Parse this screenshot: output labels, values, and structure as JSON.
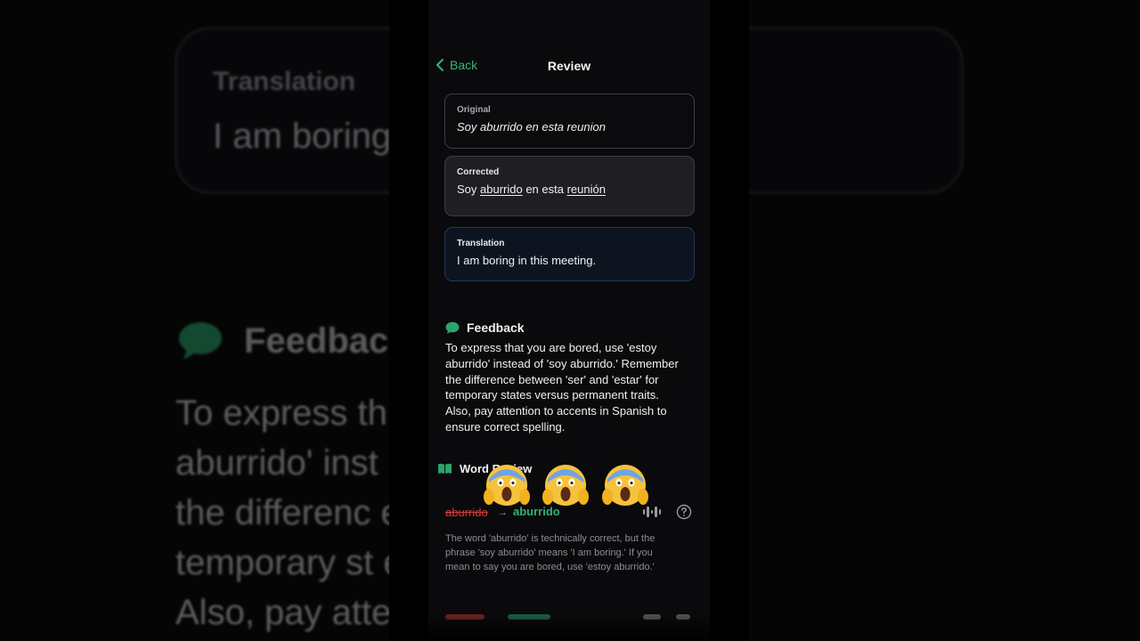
{
  "background": {
    "card_label": "Translation",
    "card_text": "I am boring",
    "feedback_title": "Feedback",
    "feedback_lines": "To express th                    e 'estoy\naburrido' inst                    .' Remember\nthe differenc                    estar' for\ntemporary st                    ent traits.\nAlso, pay atte                    Spanish to"
  },
  "nav": {
    "back_label": "Back",
    "title": "Review"
  },
  "original": {
    "label": "Original",
    "text": "Soy aburrido en esta reunion"
  },
  "corrected": {
    "label": "Corrected",
    "parts": [
      "Soy ",
      "aburrido",
      " en esta ",
      "reunión"
    ]
  },
  "translation": {
    "label": "Translation",
    "text": "I am boring in this meeting."
  },
  "feedback": {
    "title": "Feedback",
    "body": "To express that you are bored, use 'estoy\naburrido' instead of 'soy aburrido.' Remember\nthe difference between 'ser' and 'estar' for\ntemporary states versus permanent traits.\nAlso, pay attention to accents in Spanish to\nensure correct spelling."
  },
  "word_review": {
    "title": "Word Review",
    "items": [
      {
        "old": "aburrido",
        "new": "aburrido",
        "explanation": "The word 'aburrido' is technically correct, but the\nphrase 'soy aburrido' means 'I am boring.' If you\nmean to say you are bored, use 'estoy aburrido.'"
      }
    ]
  },
  "colors": {
    "accent": "#31b679",
    "error": "#d23b3b",
    "translation_border": "#25365a"
  },
  "icons": [
    "chevron-left-icon",
    "speech-bubble-icon",
    "book-icon",
    "screaming-face-emoji",
    "audio-waveform-icon",
    "question-circle-icon"
  ]
}
